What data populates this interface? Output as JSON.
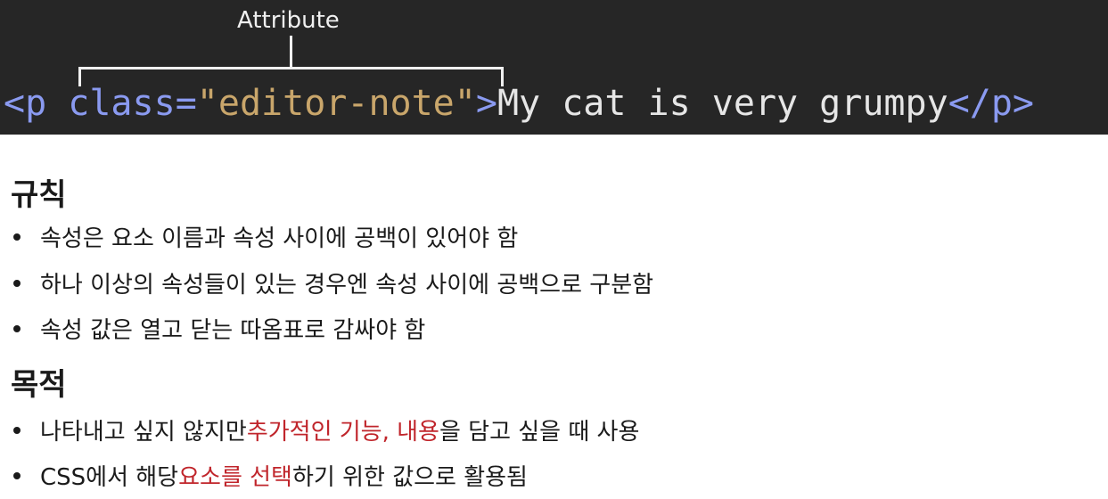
{
  "code_panel": {
    "annotation_label": "Attribute",
    "tokens": {
      "open_tag": "<p",
      "space": " ",
      "attr_name": "class",
      "equals": "=",
      "attr_value": "\"editor-note\"",
      "open_close": ">",
      "text": "My cat is very grumpy",
      "close_tag": "</p>"
    }
  },
  "rules": {
    "title": "규칙",
    "items": [
      "속성은 요소 이름과 속성 사이에 공백이 있어야 함",
      "하나 이상의 속성들이 있는 경우엔 속성 사이에 공백으로 구분함",
      "속성 값은 열고 닫는 따옴표로 감싸야 함"
    ]
  },
  "purpose": {
    "title": "목적",
    "items": [
      {
        "before": "나타내고 싶지 않지만 ",
        "highlight": "추가적인 기능, 내용",
        "after": "을 담고 싶을 때 사용"
      },
      {
        "before": "CSS에서 해당 ",
        "highlight": "요소를 선택",
        "after": "하기 위한 값으로 활용됨"
      }
    ]
  },
  "colors": {
    "code_background": "#262626",
    "tag_color": "#8a9af0",
    "value_color": "#c9a66b",
    "highlight_color": "#c0252b"
  }
}
